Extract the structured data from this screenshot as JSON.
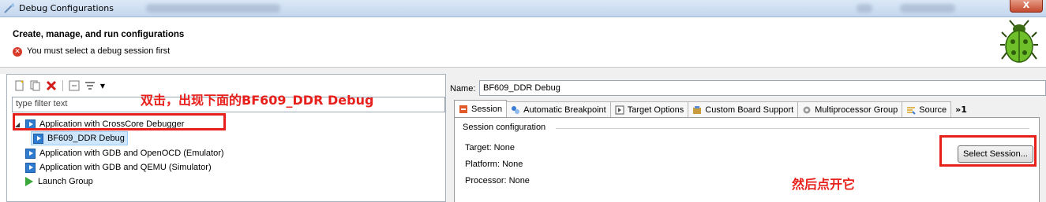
{
  "window": {
    "title": "Debug Configurations",
    "close_label": "X"
  },
  "header": {
    "title": "Create, manage, and run configurations",
    "message": "You must select a debug session first",
    "error_icon": "error-icon"
  },
  "left": {
    "filter_placeholder": "type filter text",
    "tree": [
      {
        "label": "Application with CrossCore Debugger",
        "expanded": true
      },
      {
        "label": "BF609_DDR Debug",
        "selected": true
      },
      {
        "label": "Application with GDB and OpenOCD (Emulator)"
      },
      {
        "label": "Application with GDB and QEMU (Simulator)"
      },
      {
        "label": "Launch Group"
      }
    ]
  },
  "right": {
    "name_label": "Name:",
    "name_value": "BF609_DDR Debug",
    "tabs": [
      {
        "label": "Session",
        "icon": "session-icon"
      },
      {
        "label": "Automatic Breakpoint",
        "icon": "breakpoint-icon"
      },
      {
        "label": "Target Options",
        "icon": "target-options-icon"
      },
      {
        "label": "Custom Board Support",
        "icon": "board-icon"
      },
      {
        "label": "Multiprocessor Group",
        "icon": "gear-icon"
      },
      {
        "label": "Source",
        "icon": "source-icon"
      }
    ],
    "tabs_more": "»1",
    "session": {
      "group_title": "Session configuration",
      "target": "Target: None",
      "platform": "Platform: None",
      "processor": "Processor: None",
      "select_button": "Select Session..."
    }
  },
  "annotations": {
    "top": "双击，出现下面的BF609_DDR Debug",
    "bottom": "然后点开它",
    "color": "#e8201c"
  }
}
